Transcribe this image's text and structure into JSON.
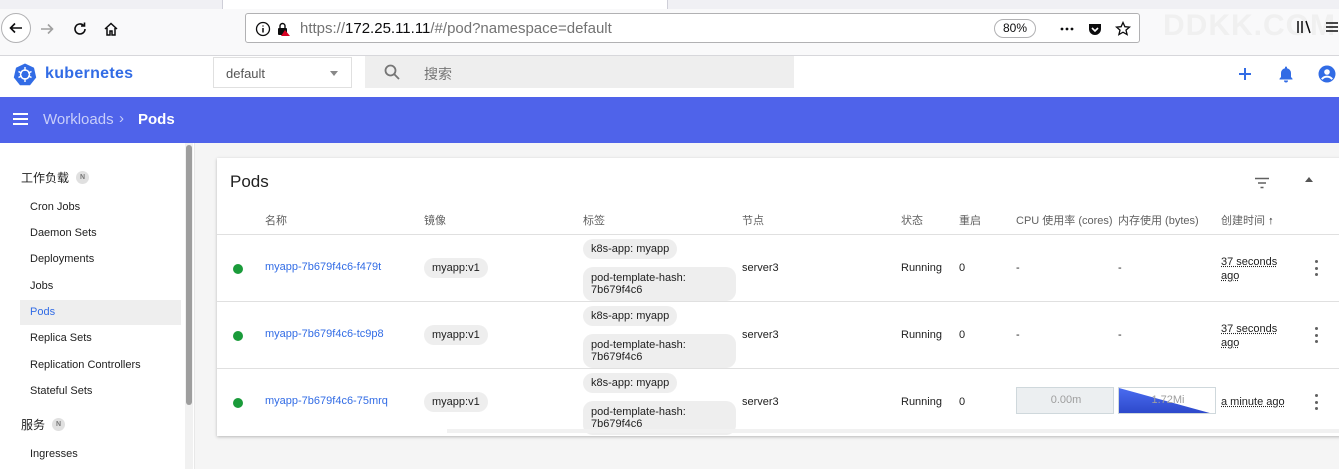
{
  "browser": {
    "url_prefix": "https://",
    "url_host": "172.25.11.11",
    "url_path": "/#/pod?namespace=default",
    "zoom": "80%",
    "watermark": "DDKK.COM"
  },
  "app": {
    "logo_text": "kubernetes",
    "namespace": "default",
    "search_placeholder": "搜索",
    "accent_color": "#326ce5",
    "nav_color": "#4f63ea"
  },
  "breadcrumb": {
    "parent": "Workloads",
    "separator": "›",
    "current": "Pods"
  },
  "sidebar": {
    "sections": [
      {
        "label": "工作负载",
        "badge": "N"
      },
      {
        "label": "服务",
        "badge": "N"
      }
    ],
    "workload_items": [
      {
        "label": "Cron Jobs"
      },
      {
        "label": "Daemon Sets"
      },
      {
        "label": "Deployments"
      },
      {
        "label": "Jobs"
      },
      {
        "label": "Pods",
        "active": true
      },
      {
        "label": "Replica Sets"
      },
      {
        "label": "Replication Controllers"
      },
      {
        "label": "Stateful Sets"
      }
    ],
    "service_items": [
      {
        "label": "Ingresses"
      }
    ]
  },
  "card": {
    "title": "Pods",
    "columns": [
      "名称",
      "镜像",
      "标签",
      "节点",
      "状态",
      "重启",
      "CPU 使用率 (cores)",
      "内存使用 (bytes)",
      "创建时间"
    ],
    "sort_indicator": "↑",
    "rows": [
      {
        "name": "myapp-7b679f4c6-f479t",
        "image": "myapp:v1",
        "label1": "k8s-app: myapp",
        "label2": "pod-template-hash: 7b679f4c6",
        "node": "server3",
        "status": "Running",
        "restarts": "0",
        "cpu": "-",
        "mem": "-",
        "created": "37 seconds ago"
      },
      {
        "name": "myapp-7b679f4c6-tc9p8",
        "image": "myapp:v1",
        "label1": "k8s-app: myapp",
        "label2": "pod-template-hash: 7b679f4c6",
        "node": "server3",
        "status": "Running",
        "restarts": "0",
        "cpu": "-",
        "mem": "-",
        "created": "37 seconds ago"
      },
      {
        "name": "myapp-7b679f4c6-75mrq",
        "image": "myapp:v1",
        "label1": "k8s-app: myapp",
        "label2": "pod-template-hash: 7b679f4c6",
        "node": "server3",
        "status": "Running",
        "restarts": "0",
        "cpu_spark": "0.00m",
        "mem_spark": "1.72Mi",
        "created": "a minute ago"
      }
    ]
  }
}
